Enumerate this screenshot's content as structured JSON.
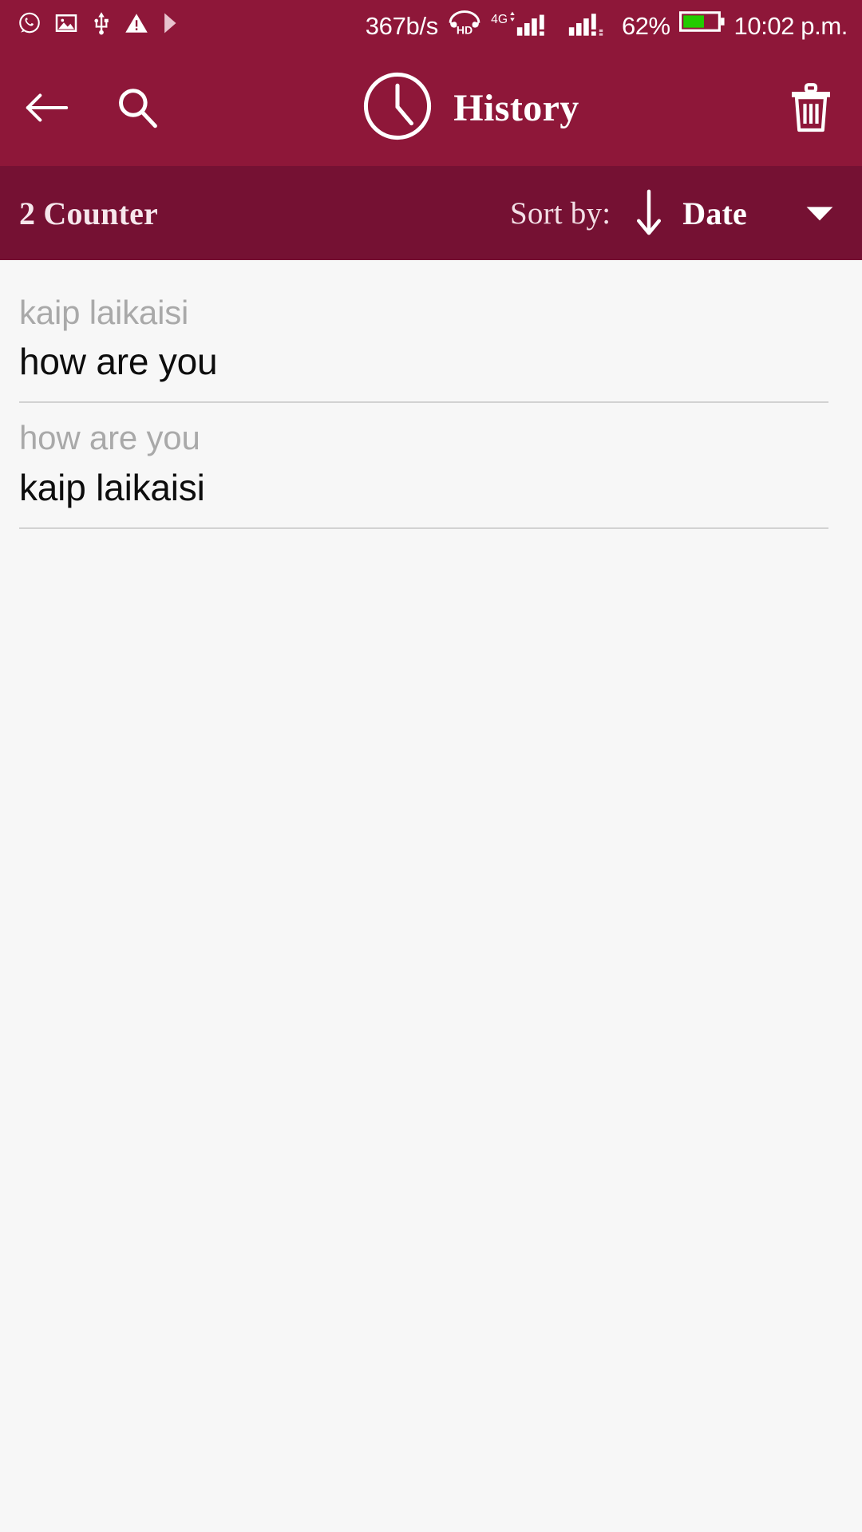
{
  "status_bar": {
    "background": "#8E1739",
    "left_icons": [
      {
        "name": "whatsapp-icon",
        "label": "WhatsApp"
      },
      {
        "name": "image-icon",
        "label": "Gallery"
      },
      {
        "name": "usb-icon",
        "label": "USB"
      },
      {
        "name": "warning-icon",
        "label": "Warning"
      },
      {
        "name": "play-icon",
        "label": "Play"
      }
    ],
    "network_speed": "367b/s",
    "hd_label": "HD",
    "network_type": "4G",
    "battery_percent": "62%",
    "time": "10:02 p.m."
  },
  "app_bar": {
    "background": "#8E1739",
    "back_label": "Back",
    "search_label": "Search",
    "clock_icon": "clock-icon",
    "title": "History",
    "delete_label": "Delete all"
  },
  "sort_bar": {
    "background": "#751133",
    "counter": "2 Counter",
    "sort_by_label": "Sort by:",
    "sort_direction": "descending",
    "sort_value": "Date",
    "dropdown_icon": "chevron-down-icon"
  },
  "history": {
    "items": [
      {
        "source": "kaip laikaisi",
        "target": "how are you"
      },
      {
        "source": "how are you",
        "target": "kaip laikaisi"
      }
    ]
  },
  "colors": {
    "primary": "#8E1739",
    "primary_dark": "#751133",
    "page_background": "#f7f7f7",
    "battery_green": "#22CC00",
    "muted_text": "#a9a9a9",
    "body_text": "#0d0d0d"
  }
}
